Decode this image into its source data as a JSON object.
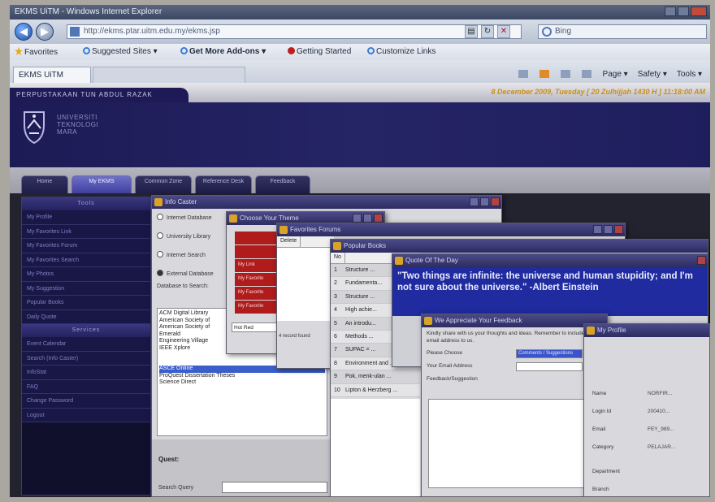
{
  "browser": {
    "title": "EKMS UiTM - Windows Internet Explorer",
    "url": "http://ekms.ptar.uitm.edu.my/ekms.jsp",
    "search_placeholder": "Bing",
    "favorites_label": "Favorites",
    "fav_items": [
      "Suggested Sites ▾",
      "Get More Add-ons ▾",
      "Getting Started",
      "Customize Links"
    ],
    "tab_title": "EKMS UiTM",
    "cmd_items": [
      "Page ▾",
      "Safety ▾",
      "Tools ▾"
    ]
  },
  "header": {
    "library": "PERPUSTAKAAN TUN ABDUL RAZAK",
    "date": "8 December 2009, Tuesday [ 20 Zulhijjah 1430 H ] 11:18:00 AM",
    "university": [
      "UNIVERSITI",
      "TEKNOLOGI",
      "MARA"
    ]
  },
  "menu_tabs": [
    "Home",
    "My EKMS",
    "Common Zone",
    "Reference Desk",
    "Feedback"
  ],
  "sidebar": {
    "tools_heading": "Tools",
    "tools": [
      "My Profile",
      "My Favorites Link",
      "My Favorites Forum",
      "My Favorites Search",
      "My Photos",
      "My Suggestion",
      "Popular Books",
      "Daily Quote"
    ],
    "services_heading": "Services",
    "services": [
      "Event Calendar",
      "Search (Info Caster)",
      "InfoStat",
      "FAQ",
      "Change Password",
      "Logout"
    ]
  },
  "info_caster": {
    "title": "Info Caster",
    "options": [
      "Internet Database",
      "University Library",
      "Internet Search",
      "External Database"
    ],
    "select_label": "Database to Search:",
    "databases": [
      "ACM Digital Library",
      "American Society of",
      "American Society of",
      "Emerald",
      "Engineering Village",
      "IEEE Xplore",
      "",
      "",
      "",
      "",
      "ASCE Online",
      "ProQuest Dissertation Theses",
      "Science Direct"
    ],
    "selected_index": 10,
    "quest_label": "Quest:",
    "search_query_label": "Search Query"
  },
  "choose_theme": {
    "title": "Choose Your Theme",
    "buttons": [
      "",
      "",
      "My Link",
      "My Favorite",
      "My Favorite",
      "My Favorite"
    ],
    "footer": "Hot Red"
  },
  "favorites_forum": {
    "title": "Favorites Forums",
    "column": "Delete",
    "footer": "4 record found"
  },
  "popular_books": {
    "title": "Popular Books",
    "column_no": "No",
    "rows": [
      {
        "no": "1",
        "title": "Structure ..."
      },
      {
        "no": "2",
        "title": "Fundamenta..."
      },
      {
        "no": "3",
        "title": "Structure ..."
      },
      {
        "no": "4",
        "title": "High achie..."
      },
      {
        "no": "5",
        "title": "An introdu..."
      },
      {
        "no": "6",
        "title": "Methods ..."
      },
      {
        "no": "7",
        "title": "SUPAC = ..."
      },
      {
        "no": "8",
        "title": "Environment and ..."
      },
      {
        "no": "9",
        "title": "Pok, menk-ulan ..."
      },
      {
        "no": "10",
        "title": "Lipton & Herzberg ..."
      }
    ]
  },
  "quote": {
    "title": "Quote Of The Day",
    "text": "\"Two things are infinite: the universe and human stupidity; and I'm not sure about the universe.\" -Albert Einstein"
  },
  "feedback": {
    "title": "We Appreciate Your Feedback",
    "intro": "Kindly share with us your thoughts and ideas. Remember to include your email address to us.",
    "fields": [
      {
        "label": "Please Choose",
        "value": "Comments / Suggestions"
      },
      {
        "label": "Your Email Address",
        "value": ""
      },
      {
        "label": "Feedback/Suggestion",
        "value": ""
      }
    ]
  },
  "profile": {
    "title": "My Profile",
    "rows": [
      {
        "label": "Name",
        "value": "NORFIR..."
      },
      {
        "label": "Login Id",
        "value": "200410..."
      },
      {
        "label": "Email",
        "value": "FEY_989..."
      },
      {
        "label": "Category",
        "value": "PELAJAR..."
      },
      {
        "label": "Department",
        "value": ""
      },
      {
        "label": "Branch",
        "value": ""
      }
    ]
  },
  "colors": {
    "banner": "#1d1b55",
    "quote_bg": "#1f2b9e",
    "theme_red": "#b01c1c",
    "date_gold": "#c9901a"
  }
}
